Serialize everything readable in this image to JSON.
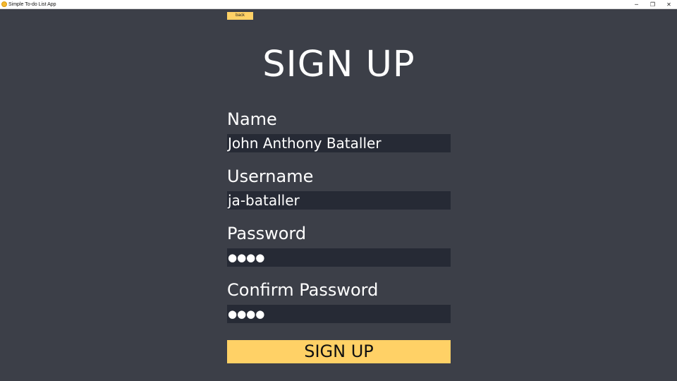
{
  "window": {
    "title": "Simple To-do List App",
    "minimize_glyph": "─",
    "maximize_glyph": "❐",
    "close_glyph": "✕"
  },
  "nav": {
    "back_label": "back"
  },
  "page": {
    "title": "SIGN UP"
  },
  "form": {
    "name_label": "Name",
    "name_value": "John Anthony Bataller",
    "username_label": "Username",
    "username_value": "ja-bataller",
    "password_label": "Password",
    "password_mask": "●●●●",
    "confirm_label": "Confirm Password",
    "confirm_mask": "●●●●",
    "submit_label": "SIGN UP"
  },
  "colors": {
    "background": "#3c3f48",
    "input_bg": "#262a35",
    "accent": "#ffd166",
    "text": "#ffffff"
  },
  "icons": {
    "app": "app-logo-icon"
  }
}
